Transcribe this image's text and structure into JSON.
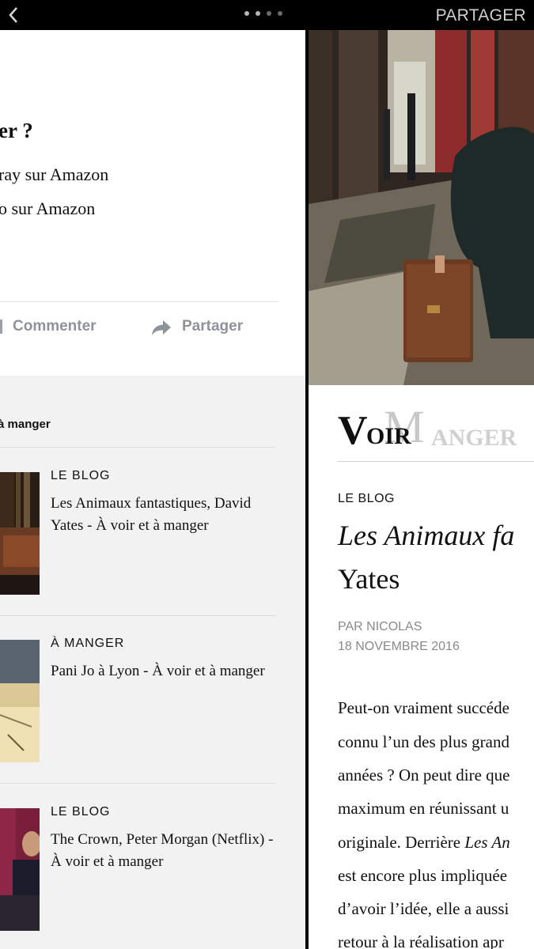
{
  "topbar": {
    "share_label": "PARTAGER",
    "page_dots": 4,
    "active_dot": 1
  },
  "left": {
    "buy_title": "er ?",
    "links": [
      "ray sur Amazon",
      "o sur Amazon"
    ],
    "actions": {
      "comment": "Commenter",
      "share": "Partager"
    },
    "related_header": "à manger",
    "cards": [
      {
        "category": "LE BLOG",
        "title": "Les Animaux fantastiques, David Yates - À voir et à manger"
      },
      {
        "category": "À MANGER",
        "title": "Pani Jo à Lyon - À voir et à manger"
      },
      {
        "category": "LE BLOG",
        "title": "The Crown, Peter Morgan (Netflix) - À voir et à manger"
      }
    ]
  },
  "right": {
    "logo_text": {
      "voir": "VOIR",
      "manger": "ANGER",
      "m": "M"
    },
    "category": "LE BLOG",
    "title_line1": "Les Animaux fa",
    "title_line2": "Yates",
    "byline": "PAR NICOLAS",
    "date": "18 NOVEMBRE 2016",
    "body_lines": [
      "Peut-on vraiment succéde",
      "connu l’un des plus grand",
      "années ? On peut dire que",
      "maximum en réunissant u",
      "originale. Derrière ",
      "est encore plus impliquée",
      "d’avoir l’idée, elle a aussi",
      "retour à la réalisation apr"
    ],
    "body_italic_fragment": "Les An"
  },
  "colors": {
    "bar": "#000000",
    "panel_bg": "#f2f2f2",
    "muted_text": "#8e939a"
  }
}
